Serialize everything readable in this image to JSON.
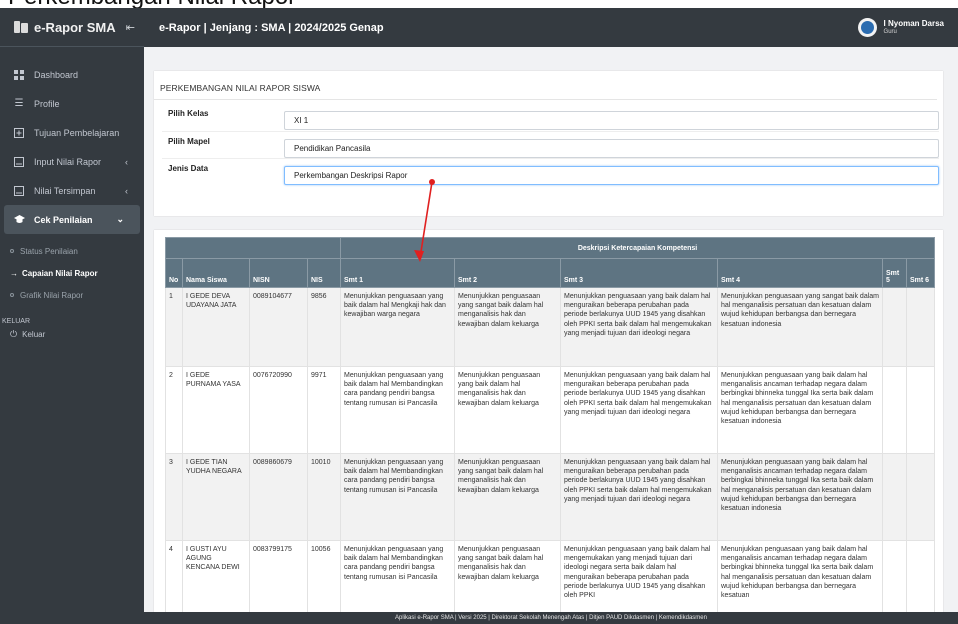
{
  "caption": "Perkembangan Nilai Rapor",
  "sidebar": {
    "brand": "e-Rapor SMA",
    "toggle": "⇤",
    "items": [
      {
        "label": "Dashboard"
      },
      {
        "label": "Profile"
      },
      {
        "label": "Tujuan Pembelajaran"
      },
      {
        "label": "Input Nilai Rapor"
      },
      {
        "label": "Nilai Tersimpan"
      },
      {
        "label": "Cek Penilaian"
      }
    ],
    "subitems": [
      {
        "label": "Status Penilaian"
      },
      {
        "label": "Capaian Nilai Rapor"
      },
      {
        "label": "Grafik Nilai Rapor"
      }
    ],
    "section": "KELUAR",
    "logout": "Keluar"
  },
  "topbar": {
    "title": "e-Rapor | Jenjang : SMA | 2024/2025 Genap",
    "user_name": "I Nyoman Darsa",
    "user_role": "Guru"
  },
  "form": {
    "card_title": "PERKEMBANGAN NILAI RAPOR SISWA",
    "kelas_label": "Pilih Kelas",
    "kelas_value": "XI 1",
    "mapel_label": "Pilih Mapel",
    "mapel_value": "Pendidikan Pancasila",
    "jenis_label": "Jenis Data",
    "jenis_value": "Perkembangan Deskripsi Rapor"
  },
  "table": {
    "group_header": "Deskripsi Ketercapaian Kompetensi",
    "headers": {
      "no": "No",
      "nama": "Nama Siswa",
      "nisn": "NISN",
      "nis": "NIS",
      "smt1": "Smt 1",
      "smt2": "Smt 2",
      "smt3": "Smt 3",
      "smt4": "Smt 4",
      "smt5": "Smt 5",
      "smt6": "Smt 6"
    },
    "rows": [
      {
        "no": "1",
        "nama": "I GEDE DEVA UDAYANA JATA",
        "nisn": "0089104677",
        "nis": "9856",
        "smt1": "Menunjukkan penguasaan yang baik dalam hal Mengkaji hak dan kewajiban warga negara",
        "smt2": "Menunjukkan penguasaan yang sangat baik dalam hal menganalisis hak dan kewajiban dalam keluarga",
        "smt3": "Menunjukkan penguasaan yang baik dalam hal menguraikan beberapa perubahan pada periode berlakunya UUD 1945 yang disahkan oleh PPKI serta baik dalam hal mengemukakan yang menjadi tujuan dari ideologi negara",
        "smt4": "Menunjukkan penguasaan yang sangat baik dalam hal menganalisis persatuan dan kesatuan dalam wujud kehidupan berbangsa dan bernegara kesatuan indonesia",
        "smt5": "",
        "smt6": ""
      },
      {
        "no": "2",
        "nama": "I GEDE PURNAMA YASA",
        "nisn": "0076720990",
        "nis": "9971",
        "smt1": "Menunjukkan penguasaan yang baik dalam hal Membandingkan cara pandang pendiri bangsa tentang rumusan isi Pancasila",
        "smt2": "Menunjukkan penguasaan yang baik dalam hal menganalisis hak dan kewajiban dalam keluarga",
        "smt3": "Menunjukkan penguasaan yang baik dalam hal menguraikan beberapa perubahan pada periode berlakunya UUD 1945 yang disahkan oleh PPKI serta baik dalam hal mengemukakan yang menjadi tujuan dari ideologi negara",
        "smt4": "Menunjukkan penguasaan yang baik dalam hal menganalisis ancaman terhadap negara dalam berbingkai bhinneka tunggal Ika serta baik dalam hal menganalisis persatuan dan kesatuan dalam wujud kehidupan berbangsa dan bernegara kesatuan indonesia",
        "smt5": "",
        "smt6": ""
      },
      {
        "no": "3",
        "nama": "I GEDE TIAN YUDHA NEGARA",
        "nisn": "0089860679",
        "nis": "10010",
        "smt1": "Menunjukkan penguasaan yang baik dalam hal Membandingkan cara pandang pendiri bangsa tentang rumusan isi Pancasila",
        "smt2": "Menunjukkan penguasaan yang sangat baik dalam hal menganalisis hak dan kewajiban dalam keluarga",
        "smt3": "Menunjukkan penguasaan yang baik dalam hal menguraikan beberapa perubahan pada periode berlakunya UUD 1945 yang disahkan oleh PPKI serta baik dalam hal mengemukakan yang menjadi tujuan dari ideologi negara",
        "smt4": "Menunjukkan penguasaan yang baik dalam hal menganalisis ancaman terhadap negara dalam berbingkai bhinneka tunggal Ika serta baik dalam hal menganalisis persatuan dan kesatuan dalam wujud kehidupan berbangsa dan bernegara kesatuan indonesia",
        "smt5": "",
        "smt6": ""
      },
      {
        "no": "4",
        "nama": "I GUSTI AYU AGUNG KENCANA DEWI",
        "nisn": "0083799175",
        "nis": "10056",
        "smt1": "Menunjukkan penguasaan yang baik dalam hal Membandingkan cara pandang pendiri bangsa tentang rumusan isi Pancasila",
        "smt2": "Menunjukkan penguasaan yang sangat baik dalam hal menganalisis hak dan kewajiban dalam keluarga",
        "smt3": "Menunjukkan penguasaan yang baik dalam hal mengemukakan yang menjadi tujuan dari ideologi negara serta baik dalam hal menguraikan beberapa perubahan pada periode berlakunya UUD 1945 yang disahkan oleh PPKI",
        "smt4": "Menunjukkan penguasaan yang baik dalam hal menganalisis ancaman terhadap negara dalam berbingkai bhinneka tunggal Ika serta baik dalam hal menganalisis persatuan dan kesatuan dalam wujud kehidupan berbangsa dan bernegara kesatuan",
        "smt5": "",
        "smt6": ""
      }
    ]
  },
  "footer": "Aplikasi e-Rapor SMA | Versi 2025 | Direktorat Sekolah Menengah Atas | Ditjen PAUD Dikdasmen | Kemendikdasmen",
  "colors": {
    "sidebar": "#343a40",
    "table_header": "#5e7482",
    "annotation": "#e02020"
  }
}
